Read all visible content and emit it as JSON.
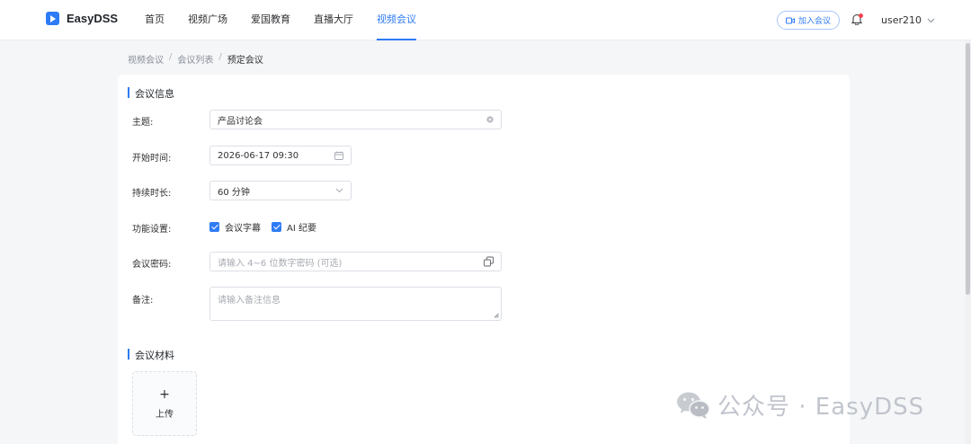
{
  "brand": {
    "name": "EasyDSS"
  },
  "nav": [
    {
      "label": "首页",
      "active": false
    },
    {
      "label": "视频广场",
      "active": false
    },
    {
      "label": "爱国教育",
      "active": false
    },
    {
      "label": "直播大厅",
      "active": false
    },
    {
      "label": "视频会议",
      "active": true
    }
  ],
  "header": {
    "join_label": "加入会议",
    "user": "user210",
    "has_notification": true
  },
  "breadcrumb": [
    "视频会议",
    "会议列表",
    "预定会议"
  ],
  "sections": {
    "info_title": "会议信息",
    "materials_title": "会议材料"
  },
  "form": {
    "topic": {
      "label": "主题:",
      "value": "产品讨论会"
    },
    "start_time": {
      "label": "开始时间:",
      "value": "2026-06-17 09:30"
    },
    "duration": {
      "label": "持续时长:",
      "value": "60 分钟"
    },
    "features": {
      "label": "功能设置:",
      "options": [
        {
          "label": "会议字幕",
          "checked": true
        },
        {
          "label": "AI 纪要",
          "checked": true
        }
      ]
    },
    "password": {
      "label": "会议密码:",
      "placeholder": "请输入 4~6 位数字密码 (可选)"
    },
    "remark": {
      "label": "备注:",
      "placeholder": "请输入备注信息"
    }
  },
  "upload": {
    "label": "上传",
    "plus": "+"
  },
  "watermark": {
    "text": "公众号 · EasyDSS"
  },
  "colors": {
    "accent": "#2f7bf5",
    "notification": "#f5404e"
  }
}
